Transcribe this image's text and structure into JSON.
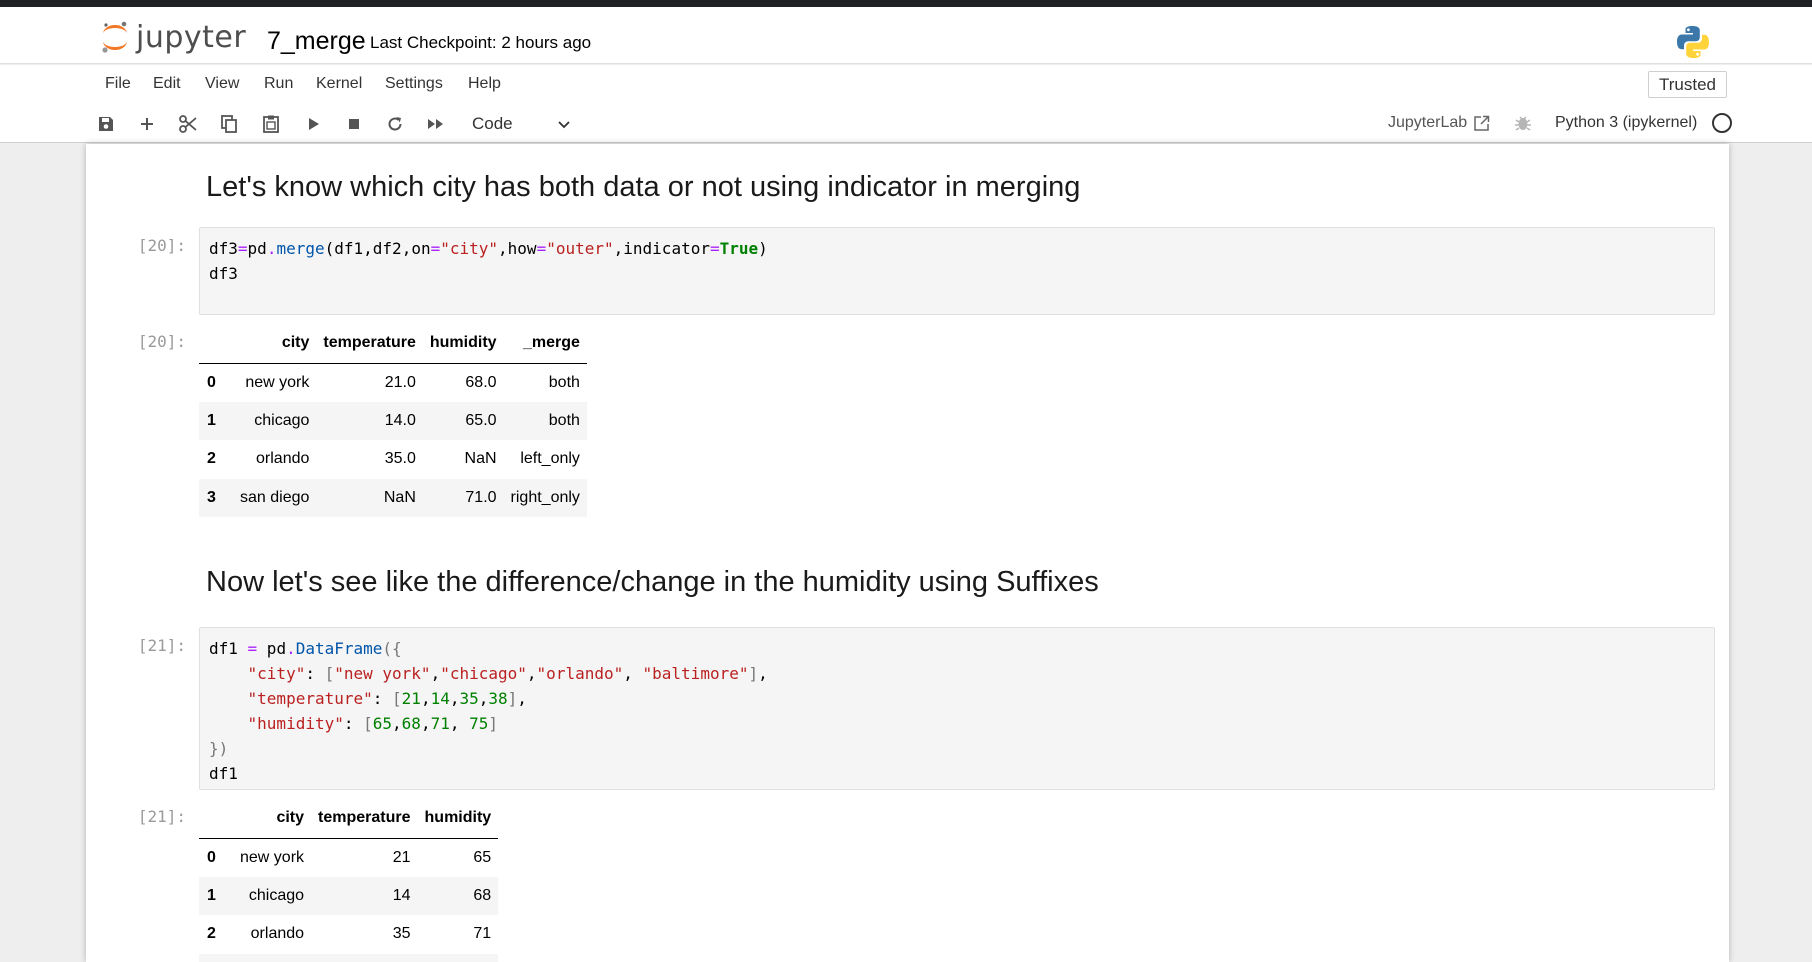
{
  "header": {
    "logo_text": "jupyter",
    "notebook_name": "7_merge",
    "checkpoint": "Last Checkpoint: 2 hours ago"
  },
  "menu": [
    "File",
    "Edit",
    "View",
    "Run",
    "Kernel",
    "Settings",
    "Help"
  ],
  "trusted_label": "Trusted",
  "toolbar": {
    "icons": [
      "save-icon",
      "plus-icon",
      "cut-icon",
      "copy-icon",
      "paste-icon",
      "run-icon",
      "stop-icon",
      "restart-icon",
      "fast-forward-icon"
    ],
    "cell_type": "Code",
    "jupyterlab_label": "JupyterLab",
    "kernel_name": "Python 3 (ipykernel)"
  },
  "cells": {
    "md1": "Let's know which city has both data or not using indicator in merging",
    "prompt20_in": "[20]:",
    "prompt20_out": "[20]:",
    "md2": "Now let's see like the difference/change in the humidity using Suffixes",
    "prompt21_in": "[21]:",
    "prompt21_out": "[21]:"
  },
  "table1": {
    "columns": [
      "city",
      "temperature",
      "humidity",
      "_merge"
    ],
    "rows": [
      {
        "index": "0",
        "city": "new york",
        "temperature": "21.0",
        "humidity": "68.0",
        "merge": "both"
      },
      {
        "index": "1",
        "city": "chicago",
        "temperature": "14.0",
        "humidity": "65.0",
        "merge": "both"
      },
      {
        "index": "2",
        "city": "orlando",
        "temperature": "35.0",
        "humidity": "NaN",
        "merge": "left_only"
      },
      {
        "index": "3",
        "city": "san diego",
        "temperature": "NaN",
        "humidity": "71.0",
        "merge": "right_only"
      }
    ]
  },
  "table2": {
    "columns": [
      "city",
      "temperature",
      "humidity"
    ],
    "rows": [
      {
        "index": "0",
        "city": "new york",
        "temperature": "21",
        "humidity": "65"
      },
      {
        "index": "1",
        "city": "chicago",
        "temperature": "14",
        "humidity": "68"
      },
      {
        "index": "2",
        "city": "orlando",
        "temperature": "35",
        "humidity": "71"
      }
    ]
  }
}
